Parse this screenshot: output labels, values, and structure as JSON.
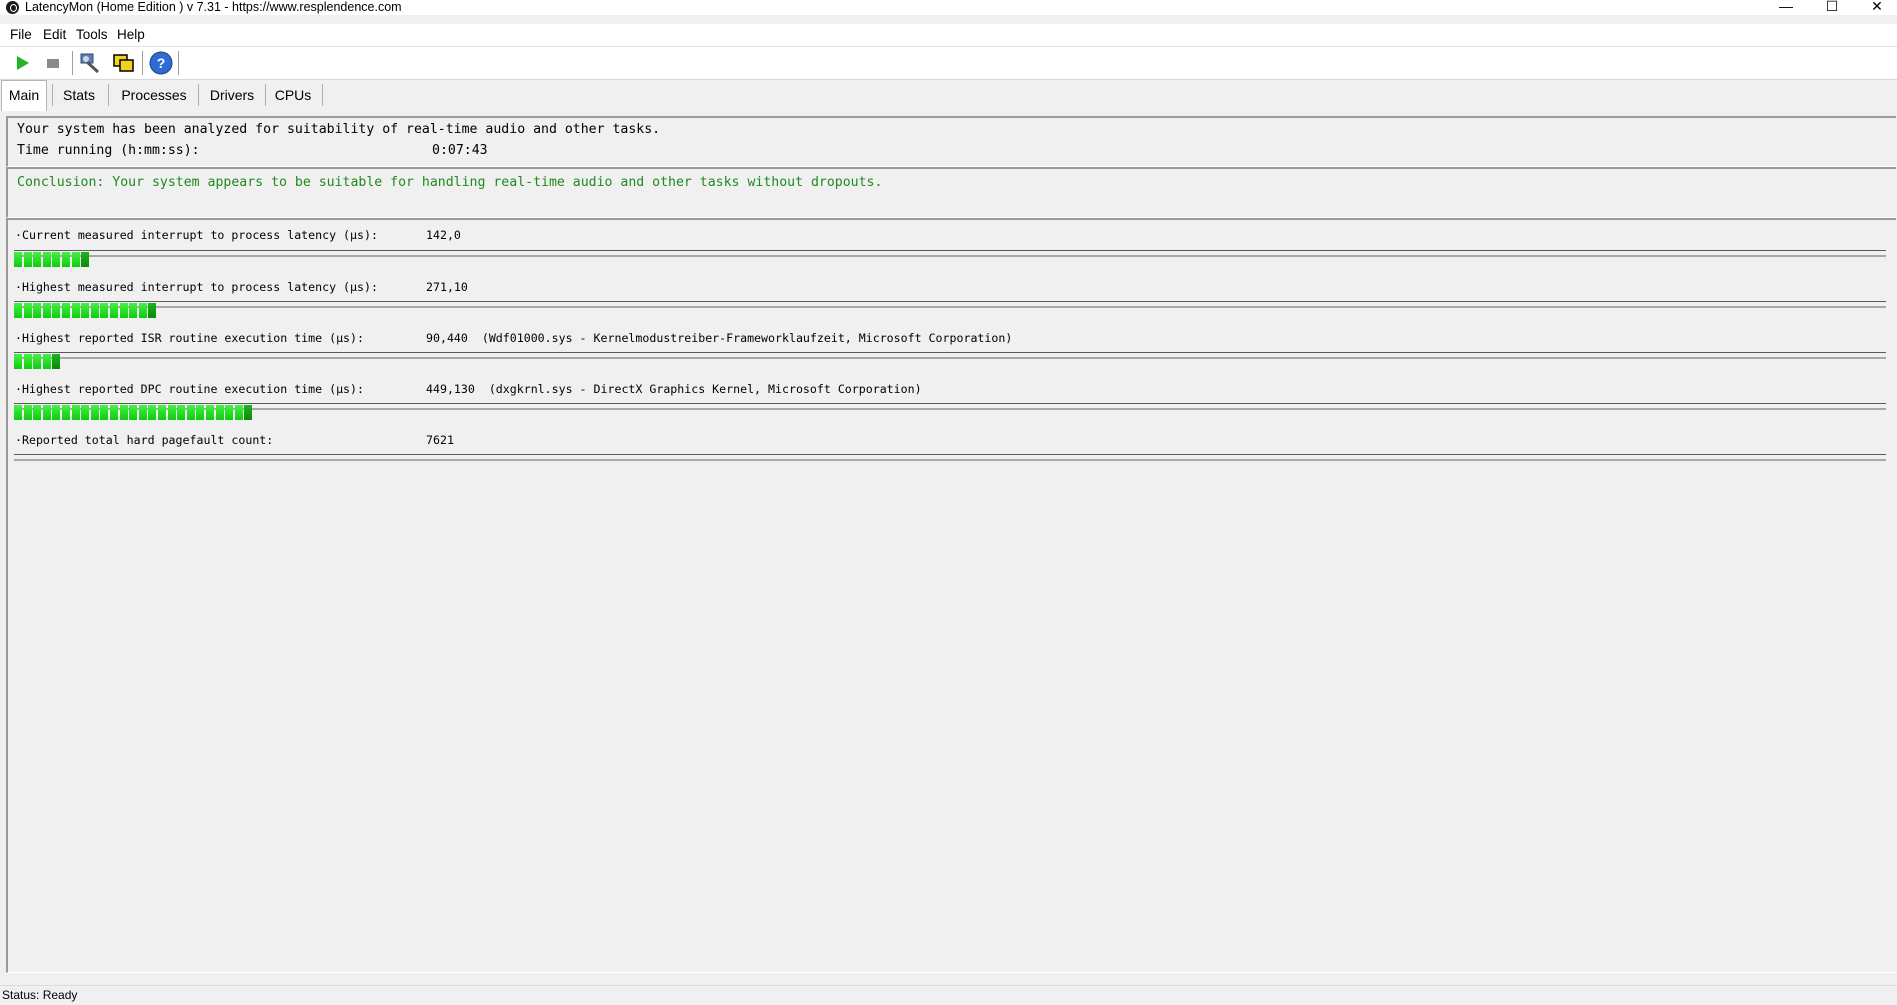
{
  "window": {
    "title": "LatencyMon  (Home Edition )  v 7.31 - https://www.resplendence.com",
    "minimize_glyph": "—",
    "maximize_glyph": "☐",
    "close_glyph": "✕"
  },
  "menu": [
    "File",
    "Edit",
    "Tools",
    "Help"
  ],
  "toolbar": {
    "buttons": [
      "play-icon",
      "stop-icon",
      "wrench-icon",
      "windows-icon",
      "help-icon"
    ]
  },
  "tabs": [
    "Main",
    "Stats",
    "Processes",
    "Drivers",
    "CPUs"
  ],
  "main": {
    "analysis_line": "Your system has been analyzed for suitability of real-time audio and other tasks.",
    "time_label": "Time running (h:mm:ss):",
    "time_value": "0:07:43",
    "conclusion": "Conclusion: Your system appears to be suitable for handling real-time audio and other tasks without dropouts.",
    "conclusion_color": "#1e8a1e",
    "metrics": [
      {
        "label": "·Current measured interrupt to process latency (µs):",
        "value": "142,0",
        "bar_segments": 8
      },
      {
        "label": "·Highest measured interrupt to process latency (µs):",
        "value": "271,10",
        "bar_segments": 15
      },
      {
        "label": "·Highest reported ISR routine execution time (µs):",
        "value": "90,440  (Wdf01000.sys - Kernelmodustreiber-Frameworklaufzeit, Microsoft Corporation)",
        "bar_segments": 5
      },
      {
        "label": "·Highest reported DPC routine execution time (µs):",
        "value": "449,130  (dxgkrnl.sys - DirectX Graphics Kernel, Microsoft Corporation)",
        "bar_segments": 25
      },
      {
        "label": "·Reported total hard pagefault count:",
        "value": "7621"
      }
    ]
  },
  "status": "Status: Ready"
}
